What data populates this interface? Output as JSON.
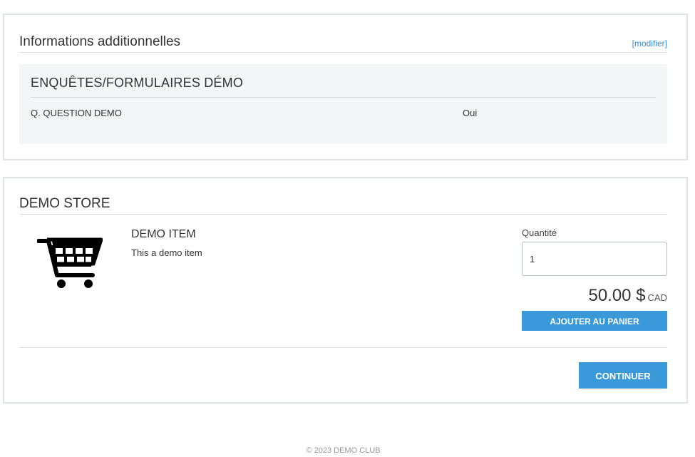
{
  "additional_info": {
    "title": "Informations additionnelles",
    "edit_link": "[modifier]",
    "survey": {
      "title": "ENQUÊTES/FORMULAIRES DÉMO",
      "rows": [
        {
          "question": "Q. QUESTION DEMO",
          "answer": "Oui"
        }
      ]
    }
  },
  "store": {
    "title": "DEMO STORE",
    "item": {
      "icon": "shopping-cart-icon",
      "name": "DEMO ITEM",
      "description": "This a demo item",
      "quantity_label": "Quantité",
      "quantity_value": "1",
      "price": "50.00 $",
      "currency": "CAD",
      "add_button": "AJOUTER AU PANIER"
    },
    "continue_button": "CONTINUER"
  },
  "footer": {
    "text": "© 2023 DEMO CLUB"
  },
  "colors": {
    "accent": "#3a9ad9",
    "link": "#2e8fd6",
    "survey_bg": "#f4f5f7",
    "border": "#dfe3e6"
  }
}
